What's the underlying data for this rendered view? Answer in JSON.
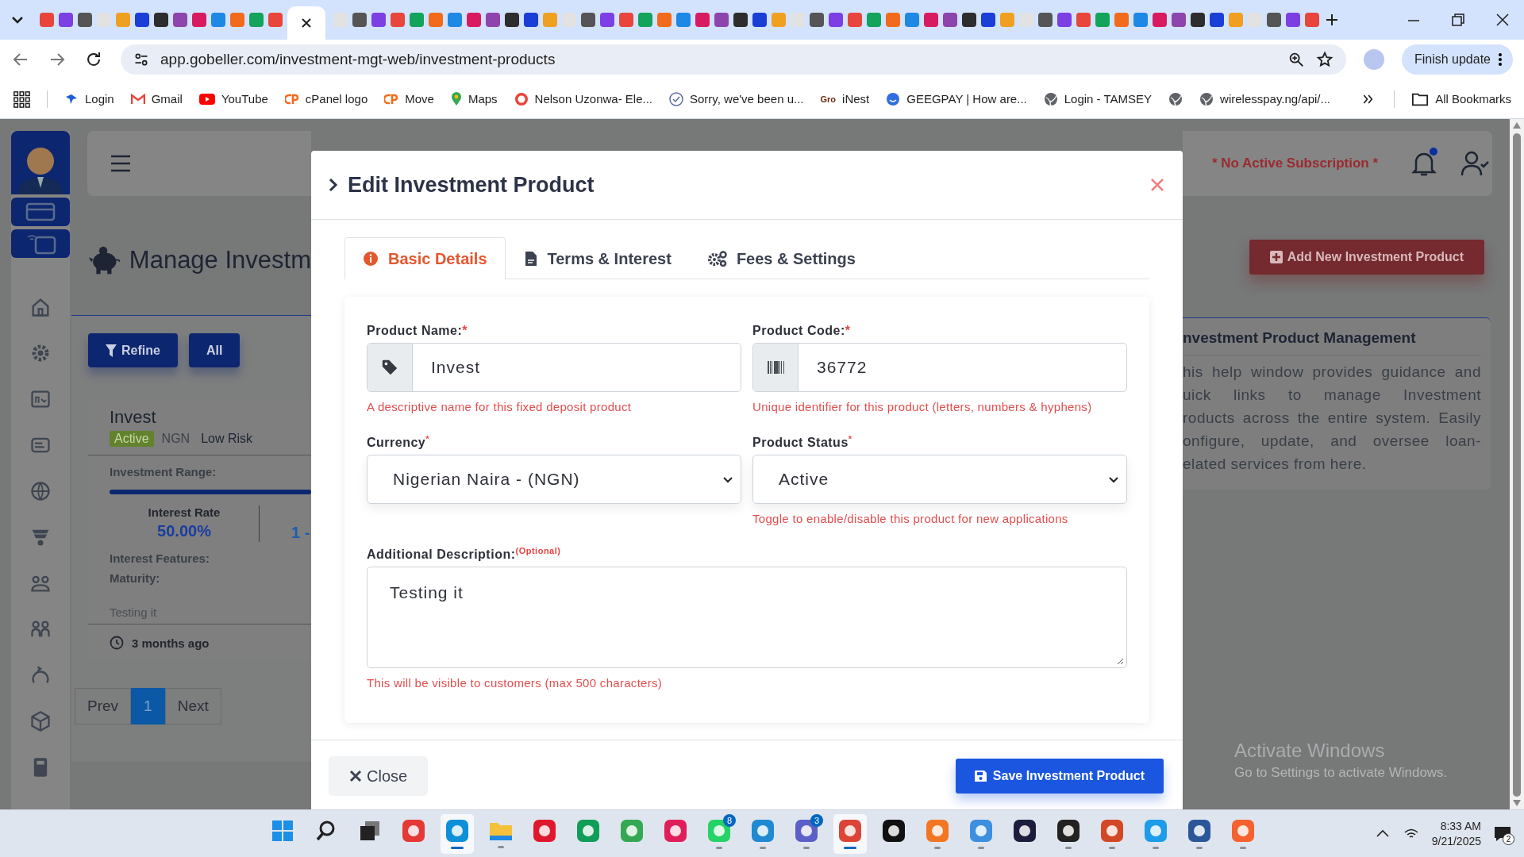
{
  "browser": {
    "url": "app.gobeller.com/investment-mgt-web/investment-products",
    "update_button": "Finish update"
  },
  "bookmarks": [
    {
      "label": "Login",
      "kind": "bird"
    },
    {
      "label": "Gmail",
      "kind": "gmail"
    },
    {
      "label": "YouTube",
      "kind": "youtube"
    },
    {
      "label": "cPanel logo",
      "kind": "cpanel"
    },
    {
      "label": "Move",
      "kind": "cpanel"
    },
    {
      "label": "Maps",
      "kind": "maps"
    },
    {
      "label": "Nelson Uzonwa- Ele...",
      "kind": "ring"
    },
    {
      "label": "Sorry, we've been u...",
      "kind": "badge"
    },
    {
      "label": "iNest",
      "kind": "text",
      "icon_text": "Gro"
    },
    {
      "label": "GEEGPAY | How are...",
      "kind": "face"
    },
    {
      "label": "Login - TAMSEY",
      "kind": "globe"
    },
    {
      "kind": "globe"
    },
    {
      "label": "wirelesspay.ng/api/...",
      "kind": "globe"
    }
  ],
  "all_bookmarks": "All Bookmarks",
  "header": {
    "subscription": "* No Active Subscription *",
    "notification_dot": true
  },
  "page": {
    "title": "Manage Investm",
    "filters": [
      {
        "label": "Refine",
        "kind": "filter"
      },
      {
        "label": "All",
        "kind": "plain"
      }
    ],
    "add_button": "Add New Investment Product"
  },
  "product_card": {
    "name": "Invest",
    "status": "Active",
    "currency": "NGN",
    "risk": "Low Risk",
    "range_label": "Investment Range:",
    "rate_label": "Interest Rate",
    "rate": "50.00%",
    "column_2": "1 -",
    "features_label": "Interest Features:",
    "maturity_label": "Maturity:",
    "description": "Testing it",
    "updated": "3 months ago"
  },
  "pagination": [
    {
      "label": "Prev",
      "selected": false
    },
    {
      "label": "1",
      "selected": true
    },
    {
      "label": "Next",
      "selected": false
    }
  ],
  "modal": {
    "title": "Edit Investment Product",
    "tabs": [
      {
        "label": "Basic Details",
        "kind": "info",
        "selected": true
      },
      {
        "label": "Terms & Interest",
        "kind": "document",
        "selected": false
      },
      {
        "label": "Fees & Settings",
        "kind": "gears",
        "selected": false
      }
    ],
    "fields": [
      {
        "label": "Product Name:",
        "mark": "*",
        "mark_raised": false,
        "kind": "tag",
        "value": "Invest",
        "hint": "A descriptive name for this fixed deposit product"
      },
      {
        "label": "Product Code:",
        "mark": "*",
        "mark_raised": false,
        "kind": "barcode",
        "value": "36772",
        "hint": "Unique identifier for this product (letters, numbers & hyphens)"
      },
      {
        "label": "Currency",
        "mark": "*",
        "mark_raised": true,
        "kind": "select",
        "value": "Nigerian Naira - (NGN)"
      },
      {
        "label": "Product Status",
        "mark": "*",
        "mark_raised": true,
        "kind": "select",
        "value": "Active",
        "hint": "Toggle to enable/disable this product for new applications"
      },
      {
        "label": "Additional Description:",
        "mark": "(Optional)",
        "mark_raised": true,
        "kind": "textarea",
        "value": "Testing it",
        "hint": "This will be visible to customers (max 500 characters)"
      }
    ],
    "close_button": "Close",
    "save_button": "Save Investment Product"
  },
  "help": {
    "title": "nvestment Product Management",
    "lines": [
      "his help window provides guidance and",
      "uick links to manage Investment",
      "roducts across the entire system. Easily",
      "onfigure, update, and oversee loan-",
      "elated services from here."
    ]
  },
  "activation": {
    "title": "Activate Windows",
    "subtitle": "Go to Settings to activate Windows."
  },
  "taskbar": {
    "apps": [
      {
        "kind": "start",
        "running": false,
        "active": false
      },
      {
        "kind": "search",
        "running": false,
        "active": false
      },
      {
        "kind": "taskview",
        "running": false,
        "active": false
      },
      {
        "kind": "remote",
        "running": false,
        "active": false
      },
      {
        "kind": "edge",
        "running": true,
        "active": true
      },
      {
        "kind": "folder",
        "running": true,
        "active": false
      },
      {
        "kind": "opera",
        "running": false,
        "active": false
      },
      {
        "kind": "pen",
        "running": false,
        "active": false
      },
      {
        "kind": "chat",
        "running": false,
        "active": false
      },
      {
        "kind": "pinwheel",
        "running": false,
        "active": false
      },
      {
        "kind": "whatsapp",
        "running": true,
        "active": false,
        "badge": "8"
      },
      {
        "kind": "code",
        "running": true,
        "active": false
      },
      {
        "kind": "teams",
        "running": true,
        "active": false,
        "badge": "3"
      },
      {
        "kind": "chrome",
        "running": true,
        "active": true
      },
      {
        "kind": "terminal",
        "running": false,
        "active": false
      },
      {
        "kind": "xampp",
        "running": true,
        "active": false
      },
      {
        "kind": "palette",
        "running": true,
        "active": false
      },
      {
        "kind": "dark",
        "running": false,
        "active": false
      },
      {
        "kind": "note",
        "running": true,
        "active": false
      },
      {
        "kind": "powerpoint",
        "running": true,
        "active": false
      },
      {
        "kind": "notepad",
        "running": true,
        "active": false
      },
      {
        "kind": "word",
        "running": true,
        "active": false
      },
      {
        "kind": "brush",
        "running": true,
        "active": false
      }
    ],
    "time": "8:33 AM",
    "date": "9/21/2025",
    "notifications": "2"
  }
}
